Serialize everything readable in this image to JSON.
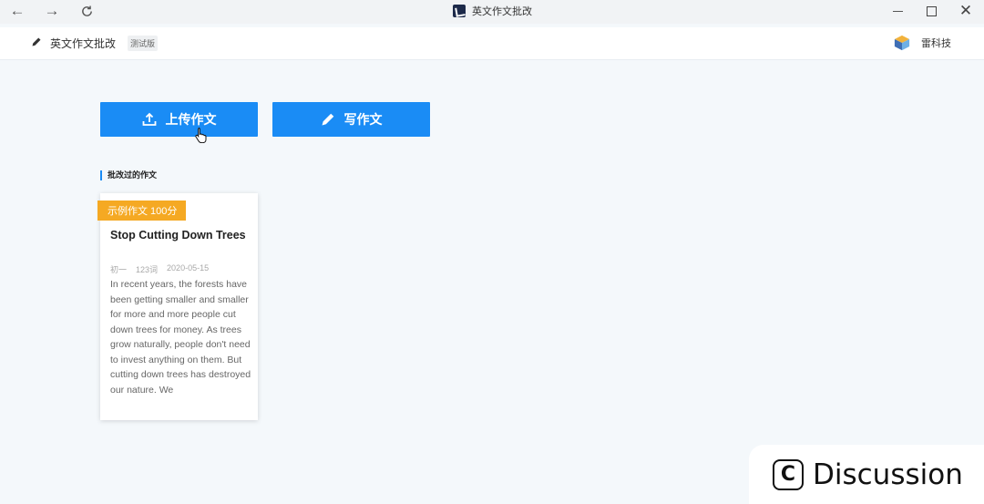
{
  "window": {
    "title": "英文作文批改",
    "controls": {
      "back": "←",
      "forward": "→",
      "close": "✕"
    }
  },
  "header": {
    "app_title": "英文作文批改",
    "badge": "测试版",
    "company": "雷科技"
  },
  "actions": {
    "upload_label": "上传作文",
    "write_label": "写作文"
  },
  "section": {
    "title": "批改过的作文"
  },
  "essays": [
    {
      "tag": "示例作文 100分",
      "title": "Stop Cutting Down Trees",
      "grade": "初一",
      "word_count": "123词",
      "date": "2020-05-15",
      "excerpt": "In recent years, the forests have been getting smaller and smaller for more and more people cut down trees for money. As trees grow naturally, people don't need to invest anything on them. But cutting down trees has destroyed our nature. We"
    }
  ],
  "watermark": {
    "logo": "C",
    "text": "Discussion"
  },
  "colors": {
    "primary": "#1a8cf5",
    "tag": "#f5a923",
    "background": "#f4f8fb"
  }
}
